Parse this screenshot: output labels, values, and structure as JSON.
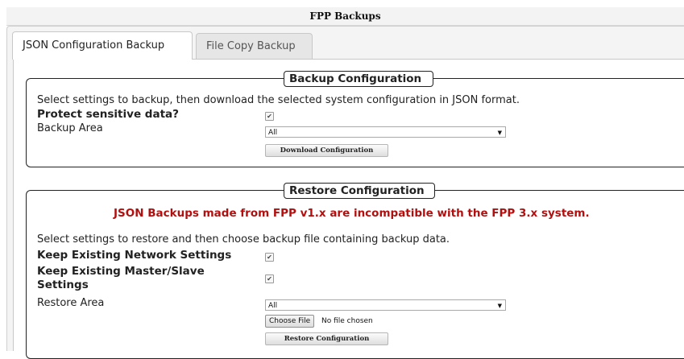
{
  "page": {
    "title": "FPP Backups"
  },
  "tabs": [
    {
      "label": "JSON Configuration Backup",
      "active": true
    },
    {
      "label": "File Copy Backup",
      "active": false
    }
  ],
  "backup": {
    "legend": "Backup Configuration",
    "description": "Select settings to backup, then download the selected system configuration in JSON format.",
    "protect_label": "Protect sensitive data?",
    "protect_checked": true,
    "area_label": "Backup Area",
    "area_value": "All",
    "download_button": "Download Configuration"
  },
  "restore": {
    "legend": "Restore Configuration",
    "warning": "JSON Backups made from FPP v1.x are incompatible with the FPP 3.x system.",
    "description": "Select settings to restore and then choose backup file containing backup data.",
    "keep_network_label": "Keep Existing Network Settings",
    "keep_network_checked": true,
    "keep_master_label_line1": "Keep Existing Master/Slave",
    "keep_master_label_line2": "Settings",
    "keep_master_checked": true,
    "area_label": "Restore Area",
    "area_value": "All",
    "choose_file_button": "Choose File",
    "file_status": "No file chosen",
    "restore_button": "Restore Configuration"
  },
  "icons": {
    "checkmark": "checkmark-icon",
    "dropdown": "dropdown-arrow-icon"
  }
}
